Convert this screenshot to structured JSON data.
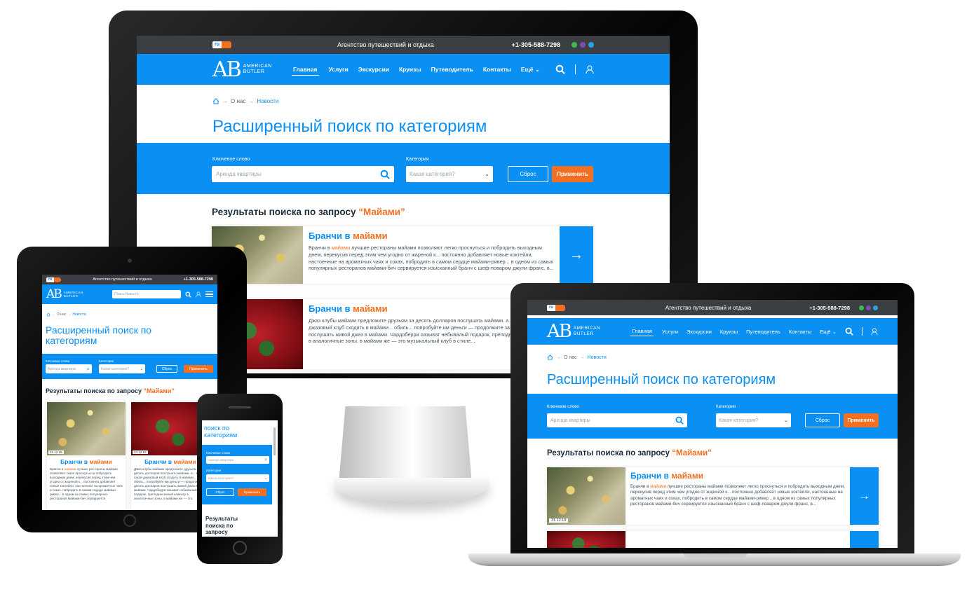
{
  "site": {
    "lang": "ru",
    "tagline": "Агентство путешествий и отдыха",
    "phone": "+1-305-588-7298",
    "logo_mark": "AB",
    "logo_name_1": "AMERICAN",
    "logo_name_2": "BUTLER",
    "menu": [
      "Главная",
      "Услуги",
      "Экскурсии",
      "Круизы",
      "Путеводитель",
      "Контакты",
      "Ещё"
    ],
    "more_caret": "⌄",
    "colors": {
      "primary": "#0a8ff2",
      "accent": "#f36f21",
      "topbar": "#3b3f44"
    }
  },
  "breadcrumb": {
    "home_icon": "home-icon",
    "sep": "→",
    "items": [
      "О нас",
      "Новости"
    ]
  },
  "page_title": "Расширенный поиск по категориям",
  "page_title_split": [
    "Расширенный поиск по",
    "категориям"
  ],
  "page_title_phone": [
    "поиск по",
    "категориям"
  ],
  "search": {
    "keyword_label": "Ключевое слово",
    "keyword_placeholder": "Аренда квартиры",
    "category_label": "Категория",
    "category_placeholder": "Какая категория?",
    "reset": "Сброс",
    "apply": "Применить",
    "tablet_search_placeholder": "Поиск Новости"
  },
  "results": {
    "prefix": "Результаты поиска по запросу",
    "query": "“Майами”",
    "phone_lines": [
      "Результаты",
      "поиска по",
      "запросу"
    ]
  },
  "cards": [
    {
      "title": "Бранчи в",
      "title_hl": "майами",
      "date": "31.12.19",
      "text_pre": "Бранчи в ",
      "text_hl": "майами",
      "text": " лучшие рестораны майами позволяют легко проснуться и побродить выходным днем, перекусив перед этим чем угодно от жареной к... постоянно добавляет новые коктейли, настоенные на ароматных чаях и соках, побродить в самом сердце майами-ривер... в одном из самых популярных ресторанов майами-бич сервируется изысканный бранч с шеф-поваром джули франс, в..."
    },
    {
      "title": "Бранчи в",
      "title_hl": "майами",
      "date": "24.12.19",
      "text_pre": "",
      "text_hl": "",
      "text": "Джаз клубы майами предложите друзьям за десять долларов послушать майами. а... в какой джазовый клуб сходить в майами... обиль... попробуйте им деньги — продолжите за десять долларов послушать живой джаз в майами. Чардоберри оазыват небывалый подарок, преподнесенный клиенту в аналогичные зоны. в майами же — это музыкальный клуб в стиле..."
    }
  ],
  "tablet_dates": [
    "31.12.19",
    "24.12.19"
  ],
  "tablet_card_titles": [
    "Бранчи в майами",
    "Бранчи в майами"
  ]
}
